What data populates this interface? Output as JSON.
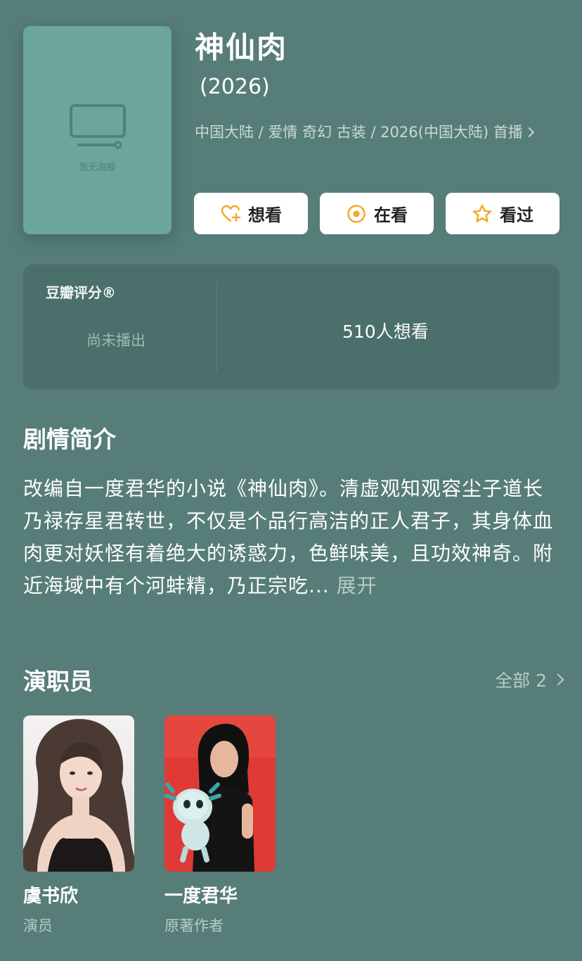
{
  "poster": {
    "placeholder_text": "暂无海报",
    "icon": "tv-icon"
  },
  "title": "神仙肉",
  "year": "(2026)",
  "meta": "中国大陆 / 爱情 奇幻 古装 / 2026(中国大陆) 首播",
  "actions": {
    "want": {
      "label": "想看",
      "icon": "heart-plus-icon"
    },
    "watching": {
      "label": "在看",
      "icon": "target-icon"
    },
    "watched": {
      "label": "看过",
      "icon": "star-icon"
    }
  },
  "rating": {
    "label": "豆瓣评分®",
    "status": "尚未播出",
    "want_count": "510人想看"
  },
  "synopsis": {
    "title": "剧情简介",
    "text": "改编自一度君华的小说《神仙肉》。清虚观知观容尘子道长乃禄存星君转世，不仅是个品行高洁的正人君子，其身体血肉更对妖怪有着绝大的诱惑力，色鲜味美，且功效神奇。附近海域中有个河蚌精，乃正宗吃...",
    "expand": "展开"
  },
  "cast": {
    "title": "演职员",
    "all_label": "全部 2",
    "members": [
      {
        "name": "虞书欣",
        "role": "演员"
      },
      {
        "name": "一度君华",
        "role": "原著作者"
      }
    ]
  },
  "colors": {
    "background": "#577d78",
    "poster": "#6ca59b",
    "card": "#4b6f6a",
    "accent": "#f5a623"
  }
}
